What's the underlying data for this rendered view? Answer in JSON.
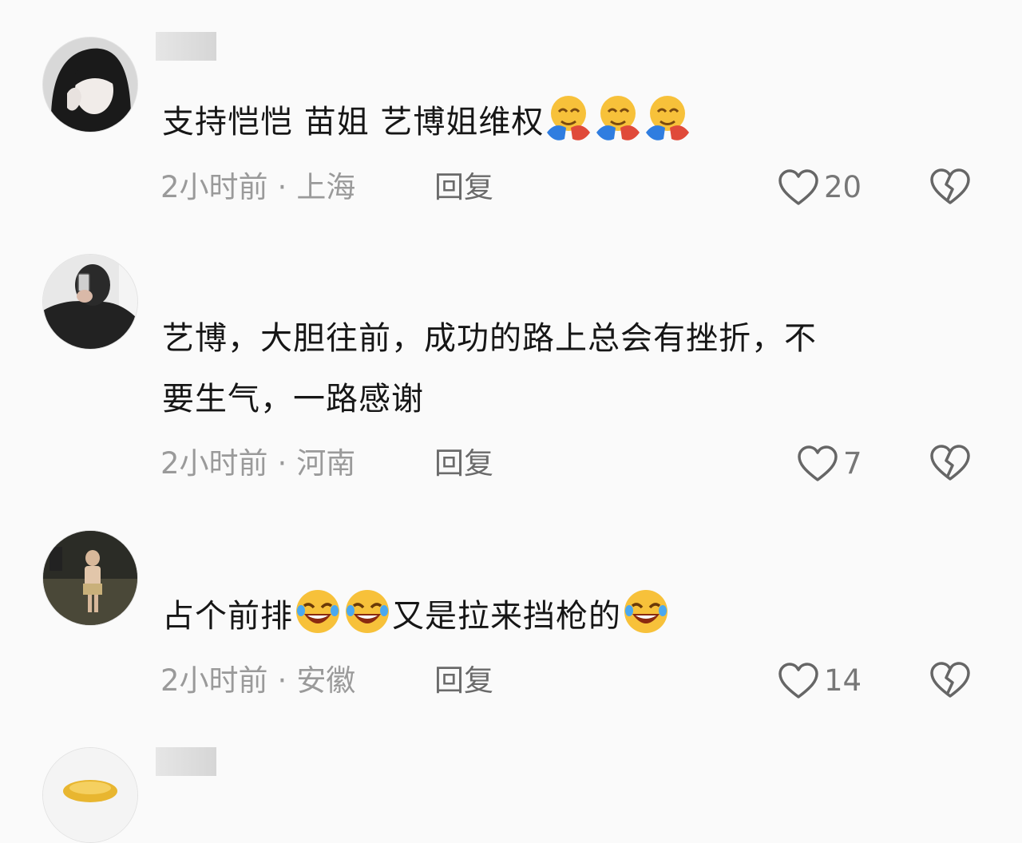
{
  "comments": [
    {
      "text_parts": [
        "支持恺恺 苗姐 艺博姐维权"
      ],
      "emoji_name": "hugging-face-emoji",
      "time": "2小时前",
      "location": "上海",
      "reply_label": "回复",
      "likes": "20"
    },
    {
      "text_line1": "艺博，大胆往前，成功的路上总会有挫折，不",
      "text_line2": "要生气，一路感谢",
      "time": "2小时前",
      "location": "河南",
      "reply_label": "回复",
      "likes": "7"
    },
    {
      "text_parts": [
        "占个前排",
        "又是拉来挡枪的"
      ],
      "emoji_name": "rolling-laughing-emoji",
      "time": "2小时前",
      "location": "安徽",
      "reply_label": "回复",
      "likes": "14"
    }
  ],
  "meta_separator": "·",
  "icons": {
    "like": "heart-outline-icon",
    "dislike": "broken-heart-icon"
  },
  "colors": {
    "background": "#fafafa",
    "text": "#161616",
    "meta": "#9a9a9a"
  }
}
